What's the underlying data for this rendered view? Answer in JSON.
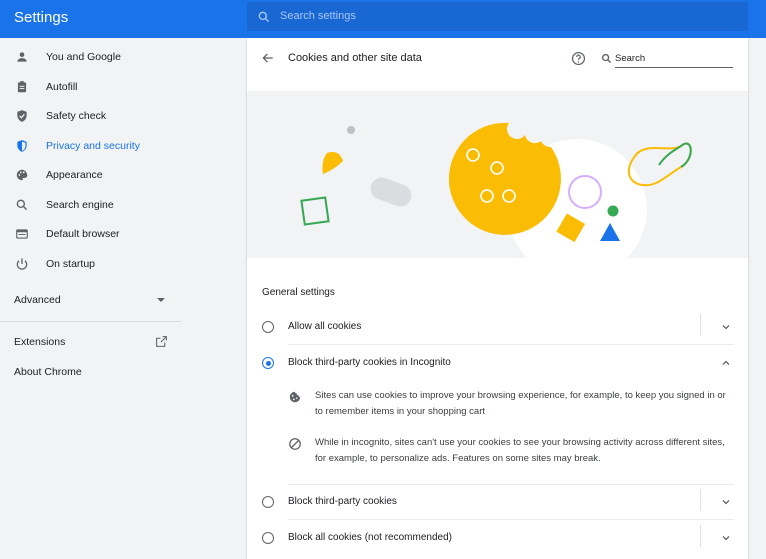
{
  "app": {
    "title": "Settings"
  },
  "search": {
    "placeholder": "Search settings"
  },
  "sidebar": {
    "items": [
      {
        "label": "You and Google",
        "icon": "person-icon",
        "active": false
      },
      {
        "label": "Autofill",
        "icon": "clipboard-icon",
        "active": false
      },
      {
        "label": "Safety check",
        "icon": "shield-check-icon",
        "active": false
      },
      {
        "label": "Privacy and security",
        "icon": "shield-icon",
        "active": true
      },
      {
        "label": "Appearance",
        "icon": "palette-icon",
        "active": false
      },
      {
        "label": "Search engine",
        "icon": "search-icon",
        "active": false
      },
      {
        "label": "Default browser",
        "icon": "browser-icon",
        "active": false
      },
      {
        "label": "On startup",
        "icon": "power-icon",
        "active": false
      }
    ],
    "advanced": "Advanced",
    "extensions": "Extensions",
    "about": "About Chrome"
  },
  "page": {
    "title": "Cookies and other site data",
    "search_placeholder": "Search",
    "general_settings": "General settings",
    "options": [
      {
        "label": "Allow all cookies",
        "selected": false,
        "expanded": false
      },
      {
        "label": "Block third-party cookies in Incognito",
        "selected": true,
        "expanded": true
      },
      {
        "label": "Block third-party cookies",
        "selected": false,
        "expanded": false
      },
      {
        "label": "Block all cookies (not recommended)",
        "selected": false,
        "expanded": false
      }
    ],
    "details": [
      {
        "icon": "cookie-icon",
        "text": "Sites can use cookies to improve your browsing experience, for example, to keep you signed in or to remember items in your shopping cart"
      },
      {
        "icon": "block-icon",
        "text": "While in incognito, sites can't use your cookies to see your browsing activity across different sites, for example, to personalize ads. Features on some sites may break."
      }
    ]
  },
  "colors": {
    "accent": "#1a73e8",
    "header": "#1a73e8",
    "cookie": "#fbbc04",
    "green": "#34a853"
  }
}
